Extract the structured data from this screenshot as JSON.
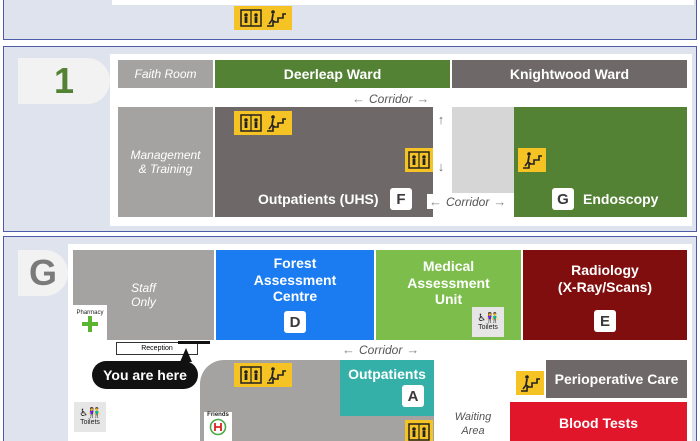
{
  "floors": [
    {
      "badge": "1",
      "rooms": {
        "faith_room": "Faith Room",
        "deerleap_ward": "Deerleap Ward",
        "knightwood_ward": "Knightwood Ward",
        "management_training": "Management\n& Training",
        "outpatients_uhs": "Outpatients (UHS)",
        "outpatients_uhs_letter": "F",
        "endoscopy": "Endoscopy",
        "endoscopy_letter": "G"
      },
      "corridors": [
        "Corridor",
        "Corridor"
      ]
    },
    {
      "badge": "G",
      "rooms": {
        "staff_only": "Staff\nOnly",
        "forest_assessment": "Forest\nAssessment\nCentre",
        "forest_letter": "D",
        "medical_assessment": "Medical\nAssessment\nUnit",
        "radiology": "Radiology\n(X-Ray/Scans)",
        "radiology_letter": "E",
        "outpatients": "Outpatients",
        "outpatients_letter": "A",
        "perioperative": "Perioperative Care",
        "blood_tests": "Blood Tests",
        "waiting_area": "Waiting\nArea"
      },
      "corridor": "Corridor",
      "pharmacy": "Pharmacy",
      "reception": "Reception",
      "you_are_here": "You are here",
      "toilets": "Toilets",
      "friends": "Friends"
    }
  ],
  "colors": {
    "panel_border": "#4e5ca8",
    "panel_bg": "#dfe3ee",
    "sign_yellow": "#f6c325",
    "green_ward": "#548235",
    "light_green": "#7cbd4b",
    "blue": "#1a7cf0",
    "maroon": "#800e0e",
    "teal": "#34b0a8",
    "red": "#e2162b"
  }
}
